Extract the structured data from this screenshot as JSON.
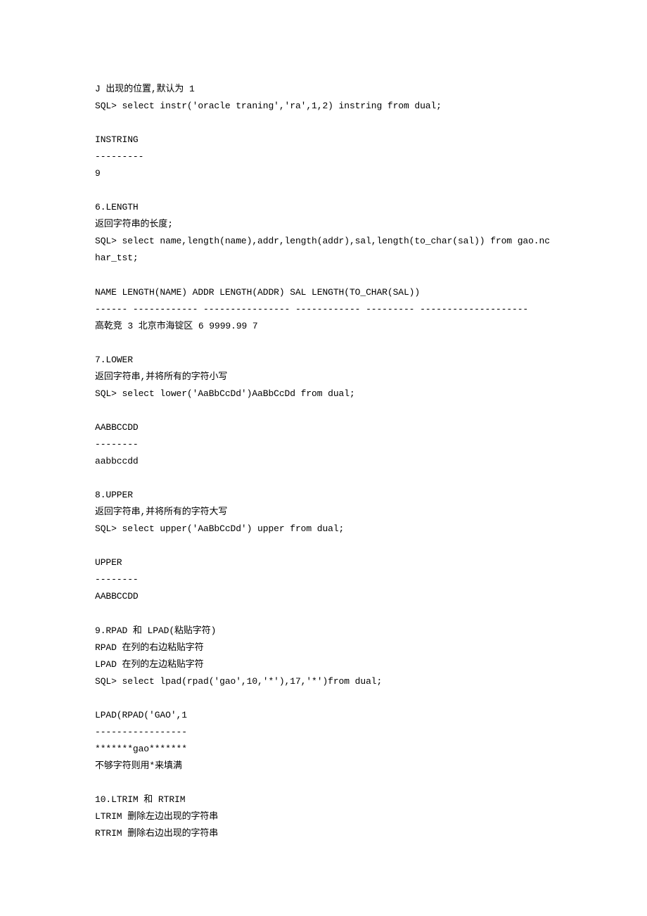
{
  "lines": [
    "J 出现的位置,默认为 1",
    "SQL> select instr('oracle traning','ra',1,2) instring from dual;",
    "",
    "INSTRING",
    "---------",
    "9",
    "",
    "6.LENGTH",
    "返回字符串的长度;",
    "SQL> select name,length(name),addr,length(addr),sal,length(to_char(sal)) from gao.nchar_tst;",
    "",
    "NAME LENGTH(NAME) ADDR LENGTH(ADDR) SAL LENGTH(TO_CHAR(SAL))",
    "------ ------------ ---------------- ------------ --------- --------------------",
    "高乾竞 3 北京市海锭区 6 9999.99 7",
    "",
    "7.LOWER",
    "返回字符串,并将所有的字符小写",
    "SQL> select lower('AaBbCcDd')AaBbCcDd from dual;",
    "",
    "AABBCCDD",
    "--------",
    "aabbccdd",
    "",
    "8.UPPER",
    "返回字符串,并将所有的字符大写",
    "SQL> select upper('AaBbCcDd') upper from dual;",
    "",
    "UPPER",
    "--------",
    "AABBCCDD",
    "",
    "9.RPAD 和 LPAD(粘贴字符)",
    "RPAD 在列的右边粘贴字符",
    "LPAD 在列的左边粘贴字符",
    "SQL> select lpad(rpad('gao',10,'*'),17,'*')from dual;",
    "",
    "LPAD(RPAD('GAO',1",
    "-----------------",
    "*******gao*******",
    "不够字符则用*来填满",
    "",
    "10.LTRIM 和 RTRIM",
    "LTRIM 删除左边出现的字符串",
    "RTRIM 删除右边出现的字符串"
  ]
}
